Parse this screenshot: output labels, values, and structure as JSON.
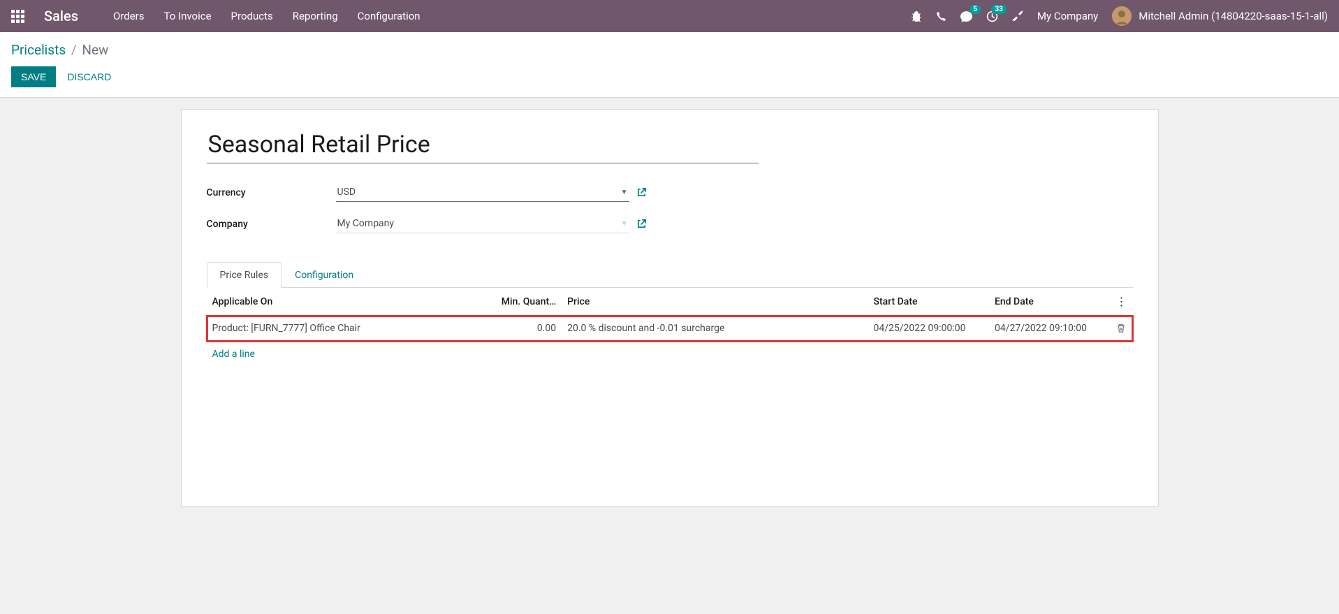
{
  "navbar": {
    "brand": "Sales",
    "menu": [
      "Orders",
      "To Invoice",
      "Products",
      "Reporting",
      "Configuration"
    ],
    "messages_badge": "5",
    "activities_badge": "33",
    "company": "My Company",
    "user": "Mitchell Admin (14804220-saas-15-1-all)"
  },
  "breadcrumb": {
    "parent": "Pricelists",
    "current": "New"
  },
  "buttons": {
    "save": "SAVE",
    "discard": "DISCARD"
  },
  "form": {
    "title": "Seasonal Retail Price",
    "currency_label": "Currency",
    "currency_value": "USD",
    "company_label": "Company",
    "company_value": "My Company"
  },
  "tabs": {
    "price_rules": "Price Rules",
    "configuration": "Configuration"
  },
  "table": {
    "headers": {
      "applicable_on": "Applicable On",
      "min_quantity": "Min. Quant…",
      "price": "Price",
      "start_date": "Start Date",
      "end_date": "End Date"
    },
    "rows": [
      {
        "applicable_on": "Product: [FURN_7777] Office Chair",
        "min_quantity": "0.00",
        "price": "20.0 % discount and -0.01 surcharge",
        "start_date": "04/25/2022 09:00:00",
        "end_date": "04/27/2022 09:10:00"
      }
    ],
    "add_line": "Add a line"
  }
}
